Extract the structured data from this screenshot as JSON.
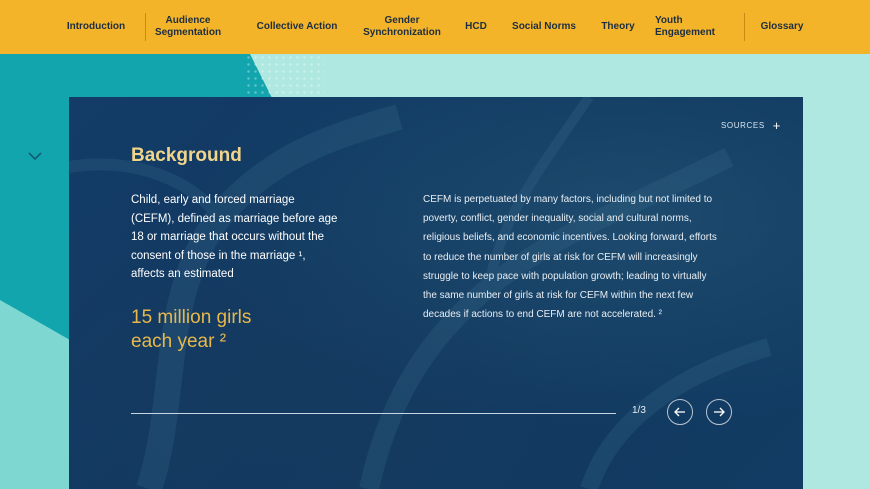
{
  "nav": {
    "items": [
      "Introduction",
      "Audience\nSegmentation",
      "Collective Action",
      "Gender\nSynchronization",
      "HCD",
      "Social Norms",
      "Theory",
      "Youth\nEngagement",
      "Glossary"
    ]
  },
  "card": {
    "sources_label": "SOURCES",
    "sources_icon": "+",
    "title": "Background",
    "intro": "Child, early and forced marriage (CEFM), defined as marriage before age 18 or marriage that occurs without the consent of those in the marriage ¹, affects an estimated",
    "stat_line1": "15 million girls",
    "stat_line2": "each year ²",
    "body": "CEFM is perpetuated by many factors, including but not limited to poverty, conflict, gender inequality, social and cultural norms, religious beliefs, and economic incentives. Looking forward, efforts to reduce the number of girls at risk for CEFM will increasingly struggle to keep pace with population growth; leading to virtually the same number of girls at risk for CEFM within the next few decades if actions to end CEFM are not accelerated. ²",
    "page_counter": "1/3"
  },
  "colors": {
    "nav_bg": "#f4b42a",
    "card_bg": "#133c67",
    "title": "#f1d58b",
    "stat": "#e8b84a",
    "teal": "#12a5ad",
    "mint": "#aee8e0"
  },
  "icons": {
    "scroll": "chevron-down-icon",
    "prev": "arrow-left-icon",
    "next": "arrow-right-icon",
    "sources_toggle": "plus-icon"
  }
}
